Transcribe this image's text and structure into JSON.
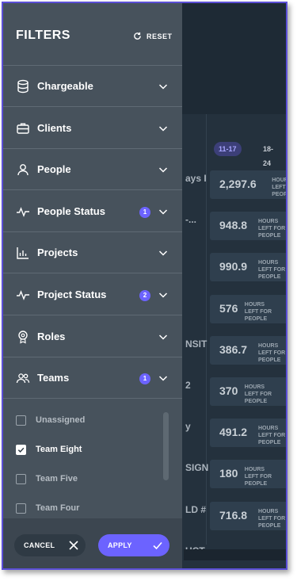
{
  "drawer": {
    "title": "FILTERS",
    "reset_label": "RESET",
    "items": [
      {
        "label": "Chargeable",
        "icon": "database-icon",
        "badge": ""
      },
      {
        "label": "Clients",
        "icon": "briefcase-icon",
        "badge": ""
      },
      {
        "label": "People",
        "icon": "person-icon",
        "badge": ""
      },
      {
        "label": "People Status",
        "icon": "activity-icon",
        "badge": "1"
      },
      {
        "label": "Projects",
        "icon": "bar-chart-icon",
        "badge": ""
      },
      {
        "label": "Project Status",
        "icon": "activity-icon",
        "badge": "2"
      },
      {
        "label": "Roles",
        "icon": "badge-icon",
        "badge": ""
      },
      {
        "label": "Teams",
        "icon": "group-icon",
        "badge": "1"
      }
    ],
    "team_options": [
      {
        "label": "Unassigned",
        "checked": false
      },
      {
        "label": "Team Eight",
        "checked": true
      },
      {
        "label": "Team Five",
        "checked": false
      },
      {
        "label": "Team Four",
        "checked": false
      }
    ],
    "cancel_label": "CANCEL",
    "apply_label": "APPLY"
  },
  "background": {
    "weeks": [
      "11-17",
      "18-24"
    ],
    "row_fragments": [
      "ays I",
      "-...",
      "",
      "",
      "NSIT",
      "2",
      "y",
      "SIGN",
      "LD #",
      "UCT"
    ],
    "cells": [
      {
        "value": "2,297.6",
        "unit": "HOURS LEFT FOR PEOPLE"
      },
      {
        "value": "948.8",
        "unit": "HOURS LEFT FOR PEOPLE"
      },
      {
        "value": "990.9",
        "unit": "HOURS LEFT FOR PEOPLE"
      },
      {
        "value": "576",
        "unit": "HOURS LEFT FOR PEOPLE"
      },
      {
        "value": "386.7",
        "unit": "HOURS LEFT FOR PEOPLE"
      },
      {
        "value": "370",
        "unit": "HOURS LEFT FOR PEOPLE"
      },
      {
        "value": "491.2",
        "unit": "HOURS LEFT FOR PEOPLE"
      },
      {
        "value": "180",
        "unit": "HOURS LEFT FOR PEOPLE"
      },
      {
        "value": "716.8",
        "unit": "HOURS LEFT FOR PEOPLE"
      }
    ]
  },
  "colors": {
    "accent": "#6c63ff",
    "drawer": "#47525c",
    "border": "#5b4fd6"
  }
}
